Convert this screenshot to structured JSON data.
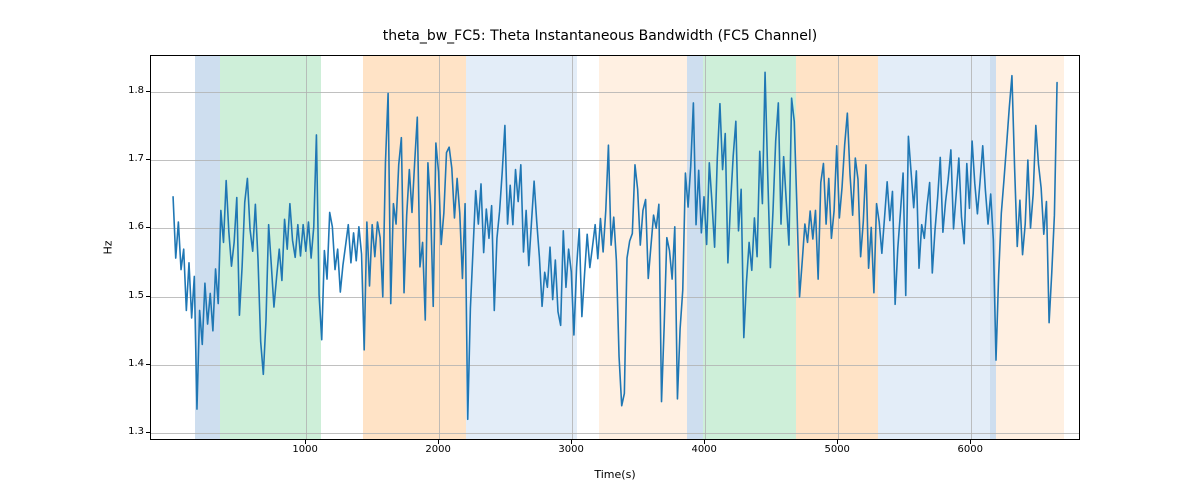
{
  "chart_data": {
    "type": "line",
    "title": "theta_bw_FC5: Theta Instantaneous Bandwidth (FC5 Channel)",
    "xlabel": "Time(s)",
    "ylabel": "Hz",
    "xlim": [
      -166.3,
      6825.3
    ],
    "ylim": [
      1.289,
      1.852
    ],
    "xticks": [
      1000,
      2000,
      3000,
      4000,
      5000,
      6000
    ],
    "yticks": [
      1.3,
      1.4,
      1.5,
      1.6,
      1.7,
      1.8
    ],
    "bands": [
      {
        "x0": 166,
        "x1": 350,
        "color": "#6699cc"
      },
      {
        "x0": 350,
        "x1": 1110,
        "color": "#66cc88"
      },
      {
        "x0": 1430,
        "x1": 2200,
        "color": "#ffa94d"
      },
      {
        "x0": 2200,
        "x1": 3040,
        "color": "#a9c6e8"
      },
      {
        "x0": 3200,
        "x1": 3860,
        "color": "#ffd0a6"
      },
      {
        "x0": 3860,
        "x1": 3980,
        "color": "#6699cc"
      },
      {
        "x0": 3980,
        "x1": 4680,
        "color": "#66cc88"
      },
      {
        "x0": 4680,
        "x1": 5300,
        "color": "#ffa94d"
      },
      {
        "x0": 5300,
        "x1": 6140,
        "color": "#a9c6e8"
      },
      {
        "x0": 6140,
        "x1": 6190,
        "color": "#6699cc"
      },
      {
        "x0": 6190,
        "x1": 6700,
        "color": "#ffd0a6"
      }
    ],
    "series": [
      {
        "name": "theta_bw_FC5",
        "color": "#1f77b4",
        "x": [
          0,
          20,
          40,
          60,
          80,
          100,
          120,
          140,
          160,
          180,
          200,
          220,
          240,
          260,
          280,
          300,
          320,
          340,
          360,
          380,
          400,
          420,
          440,
          460,
          480,
          500,
          520,
          540,
          560,
          580,
          600,
          620,
          640,
          660,
          680,
          700,
          720,
          740,
          760,
          780,
          800,
          820,
          840,
          860,
          880,
          900,
          920,
          940,
          960,
          980,
          1000,
          1020,
          1040,
          1060,
          1080,
          1100,
          1120,
          1140,
          1160,
          1180,
          1200,
          1220,
          1240,
          1260,
          1280,
          1300,
          1320,
          1340,
          1360,
          1380,
          1400,
          1420,
          1440,
          1460,
          1480,
          1500,
          1520,
          1540,
          1560,
          1580,
          1600,
          1620,
          1640,
          1660,
          1680,
          1700,
          1720,
          1740,
          1760,
          1780,
          1800,
          1820,
          1840,
          1860,
          1880,
          1900,
          1920,
          1940,
          1960,
          1980,
          2000,
          2020,
          2040,
          2060,
          2080,
          2100,
          2120,
          2140,
          2160,
          2180,
          2200,
          2220,
          2240,
          2260,
          2280,
          2300,
          2320,
          2340,
          2360,
          2380,
          2400,
          2420,
          2440,
          2460,
          2480,
          2500,
          2520,
          2540,
          2560,
          2580,
          2600,
          2620,
          2640,
          2660,
          2680,
          2700,
          2720,
          2740,
          2760,
          2780,
          2800,
          2820,
          2840,
          2860,
          2880,
          2900,
          2920,
          2940,
          2960,
          2980,
          3000,
          3020,
          3040,
          3060,
          3080,
          3100,
          3120,
          3140,
          3160,
          3180,
          3200,
          3220,
          3240,
          3260,
          3280,
          3300,
          3320,
          3340,
          3360,
          3380,
          3400,
          3420,
          3440,
          3460,
          3480,
          3500,
          3520,
          3540,
          3560,
          3580,
          3600,
          3620,
          3640,
          3660,
          3680,
          3700,
          3720,
          3740,
          3760,
          3780,
          3800,
          3820,
          3840,
          3860,
          3880,
          3900,
          3920,
          3940,
          3960,
          3980,
          4000,
          4020,
          4040,
          4060,
          4080,
          4100,
          4120,
          4140,
          4160,
          4180,
          4200,
          4220,
          4240,
          4260,
          4280,
          4300,
          4320,
          4340,
          4360,
          4380,
          4400,
          4420,
          4440,
          4460,
          4480,
          4500,
          4520,
          4540,
          4560,
          4580,
          4600,
          4620,
          4640,
          4660,
          4680,
          4700,
          4720,
          4740,
          4760,
          4780,
          4800,
          4820,
          4840,
          4860,
          4880,
          4900,
          4920,
          4940,
          4960,
          4980,
          5000,
          5020,
          5040,
          5060,
          5080,
          5100,
          5120,
          5140,
          5160,
          5180,
          5200,
          5220,
          5240,
          5260,
          5280,
          5300,
          5320,
          5340,
          5360,
          5380,
          5400,
          5420,
          5440,
          5460,
          5480,
          5500,
          5520,
          5540,
          5560,
          5580,
          5600,
          5620,
          5640,
          5660,
          5680,
          5700,
          5720,
          5740,
          5760,
          5780,
          5800,
          5820,
          5840,
          5860,
          5880,
          5900,
          5920,
          5940,
          5960,
          5980,
          6000,
          6020,
          6040,
          6060,
          6080,
          6100,
          6120,
          6140,
          6160,
          6180,
          6200,
          6220,
          6240,
          6260,
          6280,
          6300,
          6320,
          6340,
          6360,
          6380,
          6400,
          6420,
          6440,
          6460,
          6480,
          6500,
          6520,
          6540,
          6560,
          6580,
          6600,
          6620,
          6640,
          6660
        ],
        "y": [
          1.645,
          1.555,
          1.608,
          1.538,
          1.568,
          1.478,
          1.548,
          1.467,
          1.528,
          1.333,
          1.478,
          1.428,
          1.518,
          1.458,
          1.503,
          1.448,
          1.539,
          1.488,
          1.625,
          1.578,
          1.669,
          1.594,
          1.543,
          1.578,
          1.644,
          1.471,
          1.542,
          1.637,
          1.672,
          1.597,
          1.565,
          1.634,
          1.552,
          1.432,
          1.384,
          1.463,
          1.604,
          1.545,
          1.483,
          1.527,
          1.568,
          1.522,
          1.612,
          1.568,
          1.635,
          1.581,
          1.556,
          1.604,
          1.558,
          1.604,
          1.565,
          1.608,
          1.555,
          1.601,
          1.736,
          1.501,
          1.435,
          1.566,
          1.524,
          1.622,
          1.601,
          1.538,
          1.568,
          1.505,
          1.545,
          1.574,
          1.604,
          1.548,
          1.592,
          1.551,
          1.601,
          1.561,
          1.42,
          1.608,
          1.514,
          1.604,
          1.557,
          1.608,
          1.585,
          1.498,
          1.695,
          1.797,
          1.488,
          1.635,
          1.605,
          1.692,
          1.732,
          1.504,
          1.618,
          1.685,
          1.622,
          1.695,
          1.762,
          1.542,
          1.578,
          1.464,
          1.695,
          1.632,
          1.484,
          1.724,
          1.682,
          1.575,
          1.621,
          1.71,
          1.718,
          1.687,
          1.614,
          1.672,
          1.621,
          1.525,
          1.635,
          1.318,
          1.481,
          1.568,
          1.654,
          1.605,
          1.664,
          1.563,
          1.627,
          1.584,
          1.632,
          1.478,
          1.584,
          1.624,
          1.682,
          1.75,
          1.605,
          1.662,
          1.604,
          1.685,
          1.638,
          1.692,
          1.564,
          1.625,
          1.544,
          1.607,
          1.668,
          1.608,
          1.556,
          1.484,
          1.534,
          1.512,
          1.571,
          1.494,
          1.552,
          1.476,
          1.456,
          1.595,
          1.512,
          1.568,
          1.535,
          1.442,
          1.541,
          1.598,
          1.469,
          1.531,
          1.59,
          1.541,
          1.572,
          1.604,
          1.554,
          1.613,
          1.564,
          1.625,
          1.721,
          1.574,
          1.615,
          1.551,
          1.41,
          1.338,
          1.356,
          1.555,
          1.58,
          1.591,
          1.692,
          1.656,
          1.574,
          1.625,
          1.641,
          1.525,
          1.572,
          1.618,
          1.599,
          1.634,
          1.344,
          1.455,
          1.585,
          1.566,
          1.524,
          1.601,
          1.348,
          1.451,
          1.508,
          1.68,
          1.63,
          1.69,
          1.783,
          1.604,
          1.684,
          1.592,
          1.645,
          1.575,
          1.695,
          1.637,
          1.571,
          1.701,
          1.782,
          1.685,
          1.738,
          1.548,
          1.635,
          1.705,
          1.756,
          1.595,
          1.656,
          1.438,
          1.52,
          1.578,
          1.537,
          1.614,
          1.557,
          1.712,
          1.635,
          1.828,
          1.678,
          1.541,
          1.625,
          1.727,
          1.783,
          1.605,
          1.704,
          1.638,
          1.574,
          1.79,
          1.756,
          1.63,
          1.498,
          1.55,
          1.605,
          1.578,
          1.624,
          1.583,
          1.625,
          1.524,
          1.666,
          1.694,
          1.605,
          1.672,
          1.584,
          1.624,
          1.72,
          1.614,
          1.659,
          1.722,
          1.768,
          1.678,
          1.618,
          1.702,
          1.671,
          1.557,
          1.608,
          1.692,
          1.54,
          1.6,
          1.504,
          1.635,
          1.608,
          1.562,
          1.614,
          1.667,
          1.61,
          1.653,
          1.487,
          1.569,
          1.622,
          1.68,
          1.5,
          1.734,
          1.682,
          1.629,
          1.683,
          1.54,
          1.604,
          1.584,
          1.631,
          1.666,
          1.533,
          1.595,
          1.643,
          1.703,
          1.593,
          1.638,
          1.671,
          1.714,
          1.598,
          1.649,
          1.702,
          1.615,
          1.576,
          1.694,
          1.628,
          1.727,
          1.665,
          1.62,
          1.668,
          1.72,
          1.655,
          1.605,
          1.649,
          1.582,
          1.405,
          1.53,
          1.621,
          1.67,
          1.722,
          1.776,
          1.823,
          1.688,
          1.572,
          1.64,
          1.56,
          1.605,
          1.699,
          1.599,
          1.649,
          1.75,
          1.693,
          1.658,
          1.59,
          1.638,
          1.46,
          1.533,
          1.618,
          1.813
        ]
      }
    ]
  }
}
